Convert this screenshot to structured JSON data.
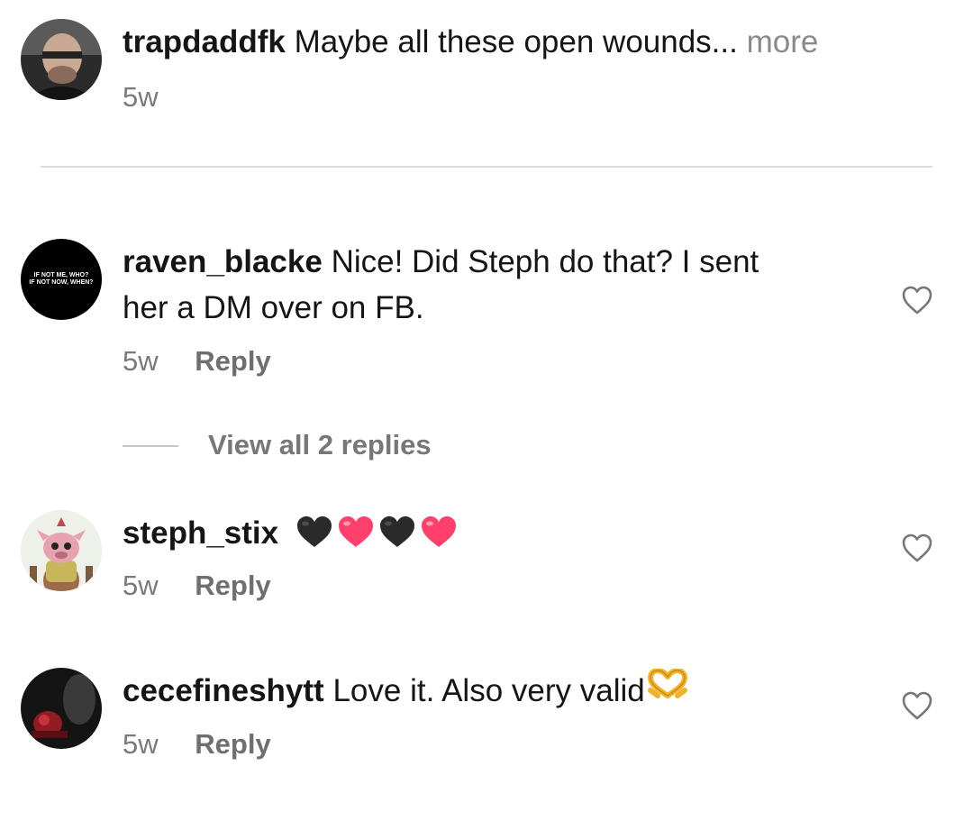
{
  "comments": [
    {
      "username": "trapdaddfk",
      "text": "Maybe all these open wounds...",
      "more_label": "more",
      "time": "5w",
      "avatar_icon": "user-photo-avatar"
    },
    {
      "username": "raven_blacke",
      "text_line1": "Nice! Did Steph do that? I sent",
      "text_line2": "her a DM over on FB.",
      "time": "5w",
      "reply_label": "Reply",
      "avatar_text_1": "IF NOT ME, WHO?",
      "avatar_text_2": "IF NOT NOW, WHEN?",
      "view_replies_label": "View all 2 replies"
    },
    {
      "username": "steph_stix",
      "emojis": [
        "black-heart",
        "pink-heart",
        "black-heart",
        "pink-heart"
      ],
      "time": "5w",
      "reply_label": "Reply",
      "avatar_icon": "illustrated-creature-avatar"
    },
    {
      "username": "cecefineshytt",
      "text": "Love it. Also very valid",
      "emoji": "heart-hands-emoji",
      "time": "5w",
      "reply_label": "Reply",
      "avatar_icon": "dark-photo-avatar"
    }
  ],
  "colors": {
    "username": "#151515",
    "secondary_text": "#7a7a7a",
    "divider": "#dcdcdc",
    "pink_heart": "#ff3f6c",
    "black_heart": "#2a2a2a"
  }
}
